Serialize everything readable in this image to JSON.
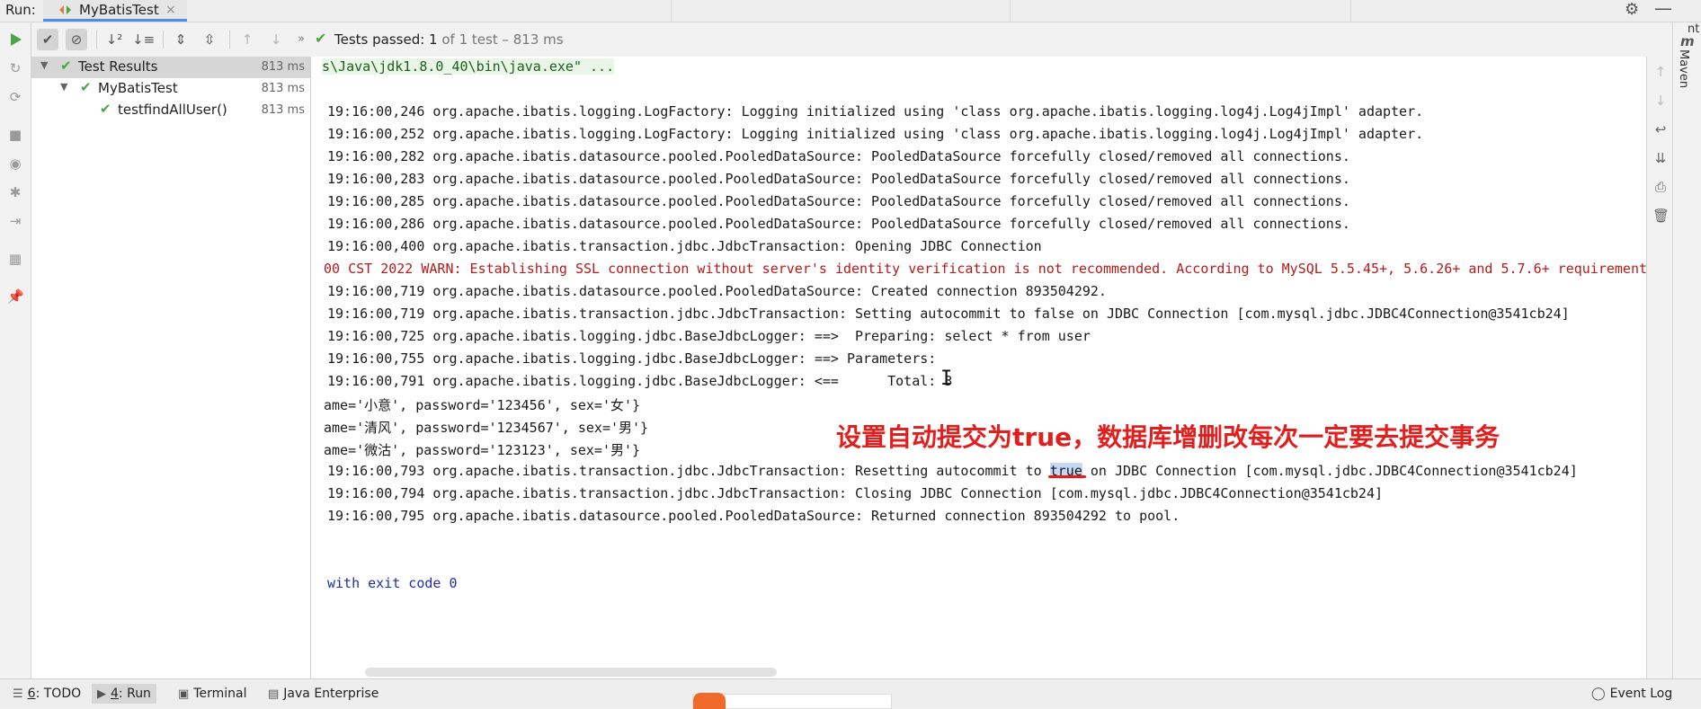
{
  "run_panel": {
    "run_label": "Run:",
    "tab_title": "MyBatisTest",
    "tab_close": "×"
  },
  "status": {
    "prefix": "Tests passed: ",
    "passed": "1",
    "suffix": " of 1 test – 813 ms"
  },
  "tree": [
    {
      "label": "Test Results",
      "time": "813 ms"
    },
    {
      "label": "MyBatisTest",
      "time": "813 ms"
    },
    {
      "label": "testfindAllUser()",
      "time": "813 ms"
    }
  ],
  "console": {
    "cmd_line": "s\\Java\\jdk1.8.0_40\\bin\\java.exe\" ...",
    "logs": [
      "19:16:00,246 org.apache.ibatis.logging.LogFactory: Logging initialized using 'class org.apache.ibatis.logging.log4j.Log4jImpl' adapter.",
      "19:16:00,252 org.apache.ibatis.logging.LogFactory: Logging initialized using 'class org.apache.ibatis.logging.log4j.Log4jImpl' adapter.",
      "19:16:00,282 org.apache.ibatis.datasource.pooled.PooledDataSource: PooledDataSource forcefully closed/removed all connections.",
      "19:16:00,283 org.apache.ibatis.datasource.pooled.PooledDataSource: PooledDataSource forcefully closed/removed all connections.",
      "19:16:00,285 org.apache.ibatis.datasource.pooled.PooledDataSource: PooledDataSource forcefully closed/removed all connections.",
      "19:16:00,286 org.apache.ibatis.datasource.pooled.PooledDataSource: PooledDataSource forcefully closed/removed all connections.",
      "19:16:00,400 org.apache.ibatis.transaction.jdbc.JdbcTransaction: Opening JDBC Connection"
    ],
    "warn_line": "00 CST 2022 WARN: Establishing SSL connection without server's identity verification is not recommended. According to MySQL 5.5.45+, 5.6.26+ and 5.7.6+ requirement",
    "logs2": [
      "19:16:00,719 org.apache.ibatis.datasource.pooled.PooledDataSource: Created connection 893504292.",
      "19:16:00,719 org.apache.ibatis.transaction.jdbc.JdbcTransaction: Setting autocommit to false on JDBC Connection [com.mysql.jdbc.JDBC4Connection@3541cb24]",
      "19:16:00,725 org.apache.ibatis.logging.jdbc.BaseJdbcLogger: ==>  Preparing: select * from user",
      "19:16:00,755 org.apache.ibatis.logging.jdbc.BaseJdbcLogger: ==> Parameters: ",
      "19:16:00,791 org.apache.ibatis.logging.jdbc.BaseJdbcLogger: <==      Total: 3"
    ],
    "users": [
      "ame='小意', password='123456', sex='女'}",
      "ame='清风', password='1234567', sex='男'}",
      "ame='微沽', password='123123', sex='男'}"
    ],
    "reset_before": "19:16:00,793 org.apache.ibatis.transaction.jdbc.JdbcTransaction: Resetting autocommit to ",
    "reset_highlight": "true",
    "reset_after": " on JDBC Connection [com.mysql.jdbc.JDBC4Connection@3541cb24]",
    "logs3": [
      "19:16:00,794 org.apache.ibatis.transaction.jdbc.JdbcTransaction: Closing JDBC Connection [com.mysql.jdbc.JDBC4Connection@3541cb24]",
      "19:16:00,795 org.apache.ibatis.datasource.pooled.PooledDataSource: Returned connection 893504292 to pool."
    ],
    "exit_line": "with exit code 0",
    "annotation": "设置自动提交为true，数据库增删改每次一定要去提交事务"
  },
  "side": {
    "maven_icon": "m",
    "maven_label": "Maven",
    "top_label": "nt"
  },
  "bottom": {
    "todo_num": "6",
    "todo_label": ": TODO",
    "run_num": "4",
    "run_label": ": Run",
    "terminal": "Terminal",
    "java_enterprise": "Java Enterprise",
    "event_log": "Event Log"
  },
  "colors": {
    "accent": "#4a8ee8",
    "pass_green": "#49a548",
    "annotation_red": "#e0201e",
    "warn_red": "#b31b1b",
    "exit_blue": "#1c2fa8"
  }
}
